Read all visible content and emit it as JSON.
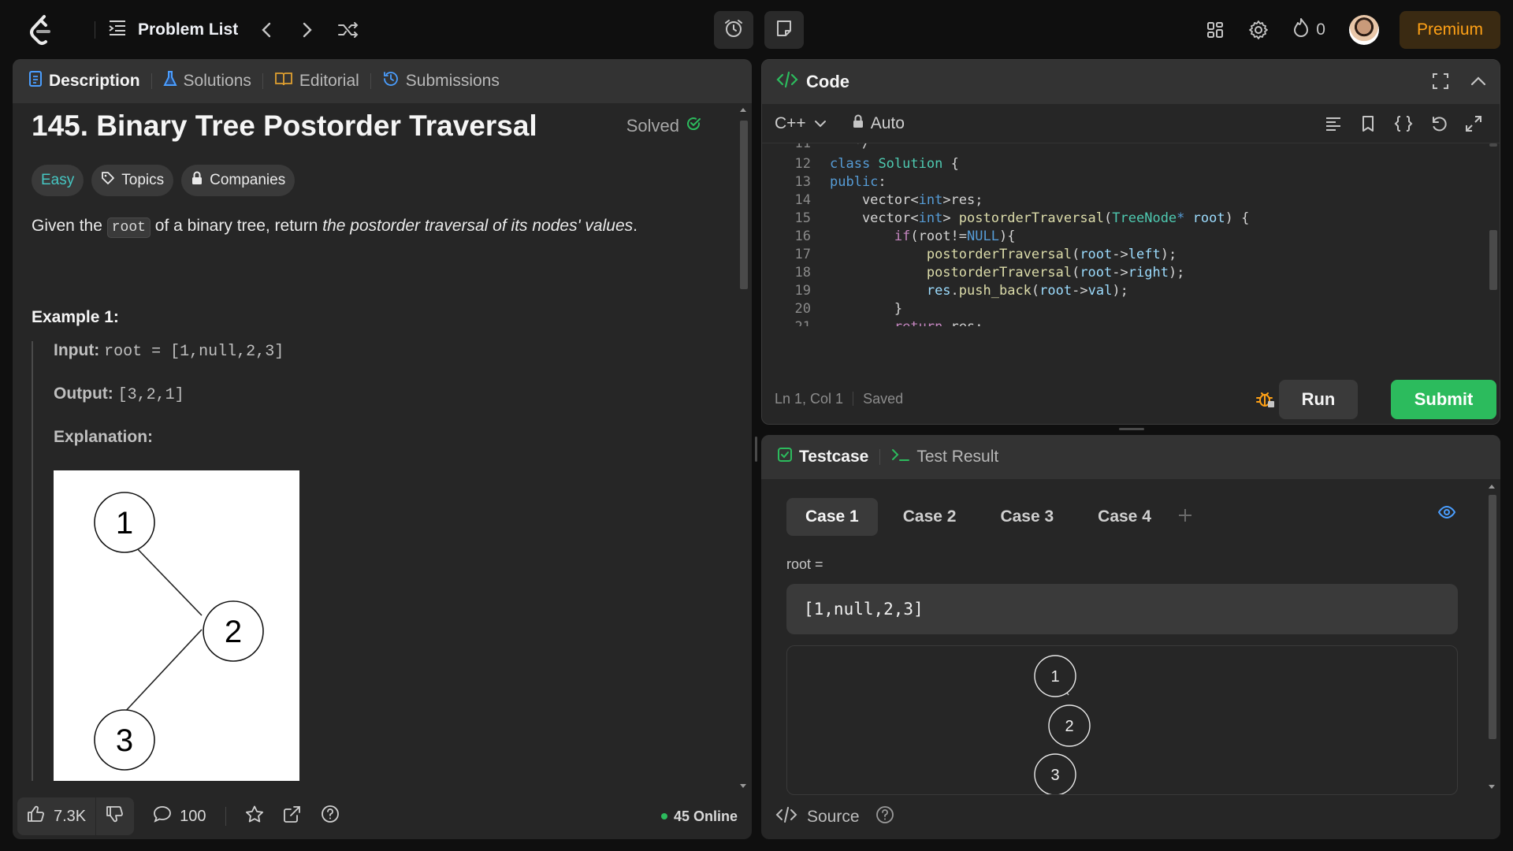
{
  "topbar": {
    "problem_list": "Problem List",
    "streak_count": "0",
    "premium": "Premium"
  },
  "left_tabs": [
    {
      "label": "Description"
    },
    {
      "label": "Solutions"
    },
    {
      "label": "Editorial"
    },
    {
      "label": "Submissions"
    }
  ],
  "problem": {
    "title": "145. Binary Tree Postorder Traversal",
    "status": "Solved",
    "difficulty": "Easy",
    "topics": "Topics",
    "companies": "Companies",
    "statement_pre": "Given the",
    "statement_code": "root",
    "statement_mid": "of a binary tree, return",
    "statement_em": "the postorder traversal of its nodes' values",
    "statement_end": "."
  },
  "example": {
    "title": "Example 1:",
    "input_label": "Input:",
    "input_value": "root = [1,null,2,3]",
    "output_label": "Output:",
    "output_value": "[3,2,1]",
    "explanation_label": "Explanation:",
    "tree_nodes": [
      "1",
      "2",
      "3"
    ]
  },
  "left_footer": {
    "likes": "7.3K",
    "comments": "100",
    "online": "45 Online"
  },
  "code_panel": {
    "title": "Code",
    "language": "C++",
    "mode": "Auto",
    "cursor": "Ln 1, Col 1",
    "saved": "Saved",
    "run": "Run",
    "submit": "Submit"
  },
  "code_lines": [
    {
      "n": "11",
      "text": "   */"
    },
    {
      "n": "12",
      "text": "class Solution {"
    },
    {
      "n": "13",
      "text": "public:"
    },
    {
      "n": "14",
      "text": "    vector<int>res;"
    },
    {
      "n": "15",
      "text": "    vector<int> postorderTraversal(TreeNode* root) {"
    },
    {
      "n": "16",
      "text": "        if(root!=NULL){"
    },
    {
      "n": "17",
      "text": "            postorderTraversal(root->left);"
    },
    {
      "n": "18",
      "text": "            postorderTraversal(root->right);"
    },
    {
      "n": "19",
      "text": "            res.push_back(root->val);"
    },
    {
      "n": "20",
      "text": "        }"
    },
    {
      "n": "21",
      "text": "        return res;"
    }
  ],
  "testcase": {
    "tab_testcase": "Testcase",
    "tab_result": "Test Result",
    "cases": [
      "Case 1",
      "Case 2",
      "Case 3",
      "Case 4"
    ],
    "var_label": "root =",
    "var_value": "[1,null,2,3]",
    "tree_nodes": [
      "1",
      "2",
      "3"
    ],
    "source": "Source"
  },
  "colors": {
    "accent_green": "#2cbb5d",
    "easy": "#46c6c2",
    "premium": "#ffa116",
    "bg": "#0f0f0f",
    "panel": "#262626"
  }
}
